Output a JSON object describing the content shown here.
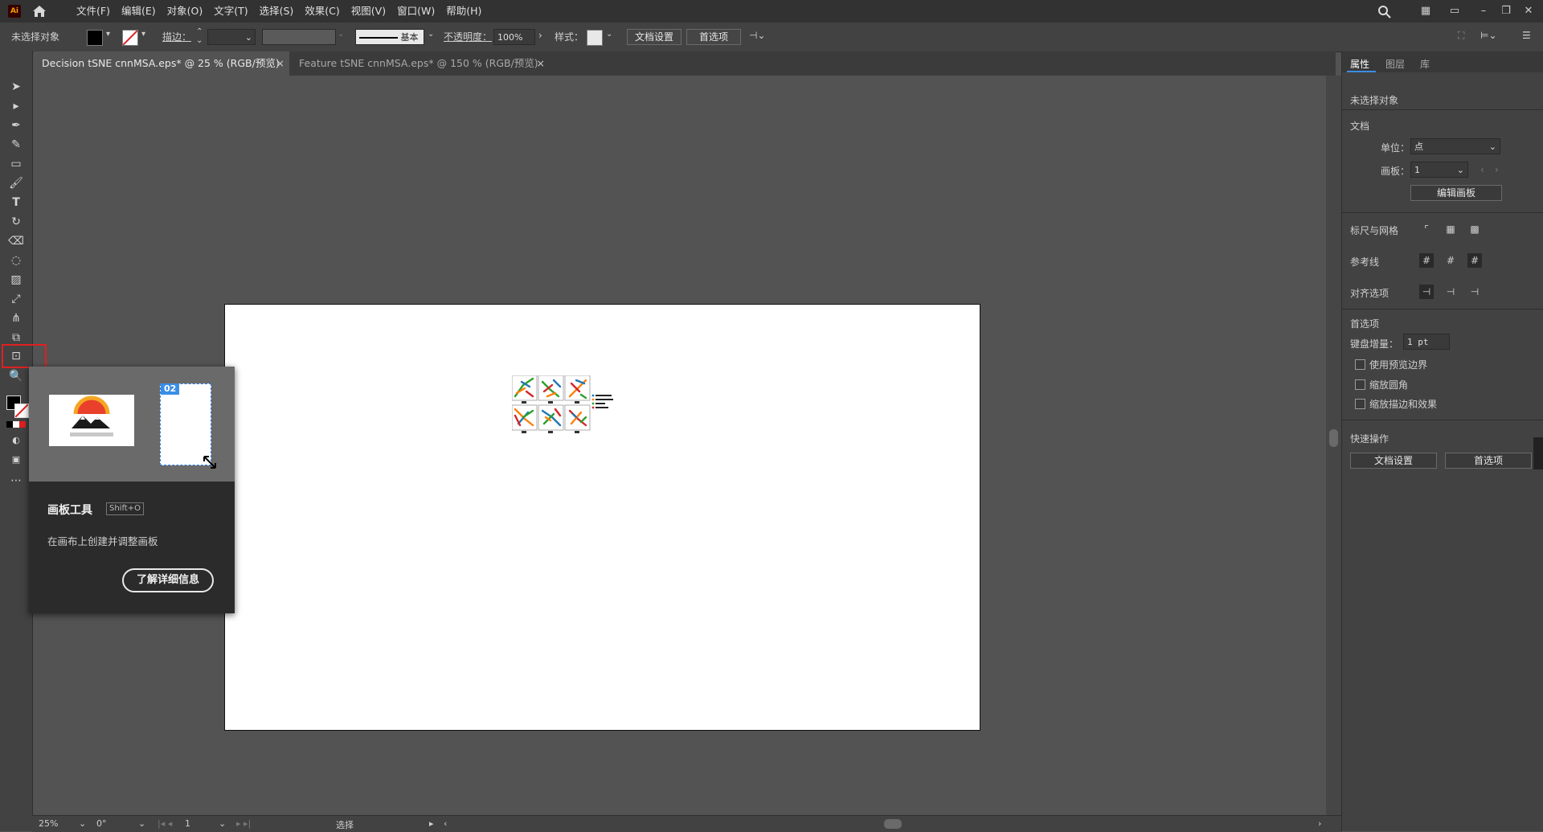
{
  "app": {
    "logo": "Ai"
  },
  "menu": [
    "文件(F)",
    "编辑(E)",
    "对象(O)",
    "文字(T)",
    "选择(S)",
    "效果(C)",
    "视图(V)",
    "窗口(W)",
    "帮助(H)"
  ],
  "control_bar": {
    "selection_label": "未选择对象",
    "stroke_label": "描边：",
    "brush_style": "基本",
    "opacity_label": "不透明度：",
    "opacity_value": "100%",
    "style_label": "样式：",
    "doc_setup": "文档设置",
    "preferences": "首选项"
  },
  "tabs": [
    {
      "label": "Decision tSNE cnnMSA.eps* @ 25 % (RGB/预览)",
      "close": "×"
    },
    {
      "label": "Feature tSNE cnnMSA.eps* @ 150 % (RGB/预览)",
      "close": "×"
    }
  ],
  "tooltip": {
    "badge": "02",
    "title": "画板工具",
    "shortcut": "Shift+O",
    "description": "在画布上创建并调整画板",
    "learn_more": "了解详细信息"
  },
  "right_panel": {
    "tabs": [
      "属性",
      "图层",
      "库"
    ],
    "no_selection": "未选择对象",
    "document": "文档",
    "units_label": "单位：",
    "units_value": "点",
    "artboard_label": "画板：",
    "artboard_value": "1",
    "edit_artboards": "编辑画板",
    "rulers_grids": "标尺与网格",
    "guides": "参考线",
    "align_options": "对齐选项",
    "preferences": "首选项",
    "keyboard_increment_label": "键盘增量：",
    "keyboard_increment_value": "1 pt",
    "use_preview_bounds": "使用预览边界",
    "scale_corners": "缩放圆角",
    "scale_strokes_effects": "缩放描边和效果",
    "quick_actions": "快速操作",
    "doc_setup": "文档设置",
    "prefs_button": "首选项"
  },
  "status_bar": {
    "zoom": "25%",
    "rotation": "0°",
    "artboard_num": "1",
    "mode": "选择"
  },
  "colors": {
    "highlight": "#e02020",
    "badge": "#3a8ee6"
  }
}
